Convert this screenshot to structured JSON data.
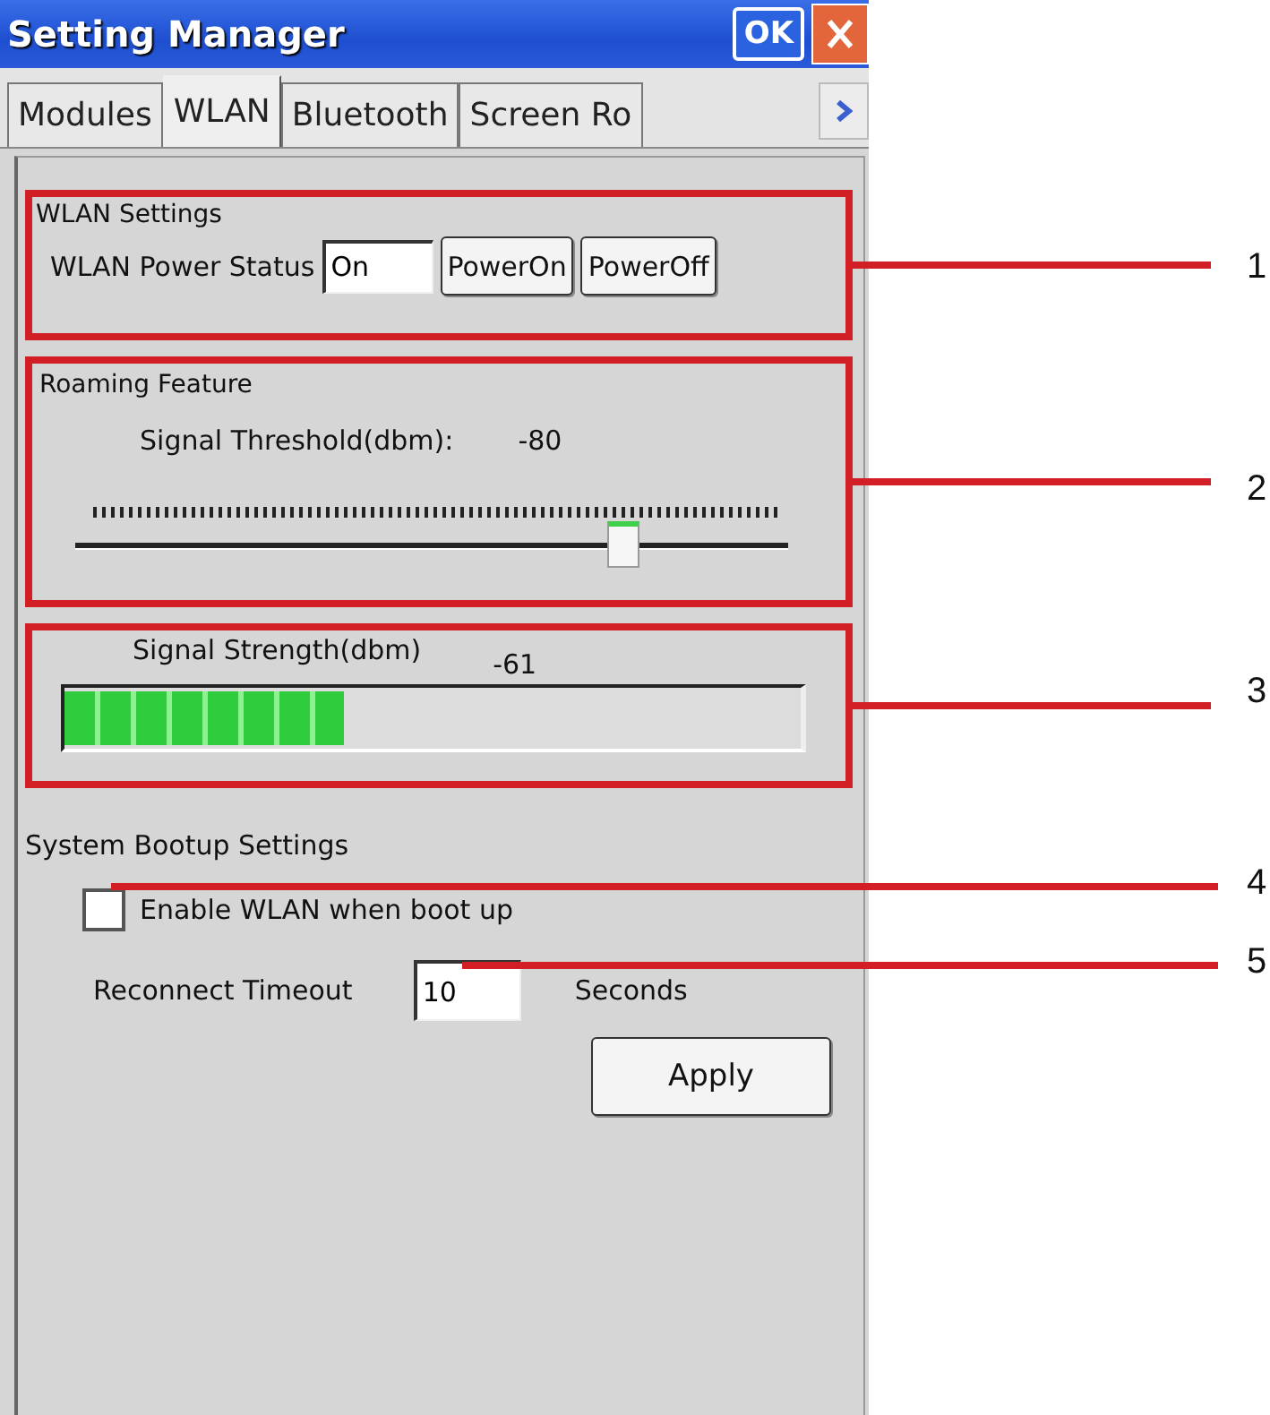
{
  "window": {
    "title": "Setting Manager",
    "ok_button": "OK"
  },
  "tabs": [
    {
      "label": "Modules",
      "selected": false
    },
    {
      "label": "WLAN",
      "selected": true
    },
    {
      "label": "Bluetooth",
      "selected": false
    },
    {
      "label": "Screen Ro",
      "selected": false
    }
  ],
  "wlan_settings": {
    "title": "WLAN Settings",
    "power_status_label": "WLAN Power Status",
    "power_status_value": "On",
    "buttons": [
      "PowerOn",
      "PowerOff"
    ]
  },
  "roaming_feature": {
    "title": "Roaming Feature",
    "threshold_label": "Signal Threshold(dbm):",
    "threshold_value": "-80",
    "slider": {
      "level": 0.77
    }
  },
  "signal": {
    "label": "Signal Strength(dbm)",
    "value": "-61",
    "level": 0.38
  },
  "bootup_settings": {
    "title": "System Bootup Settings",
    "enable_checkbox": {
      "label": "Enable WLAN when boot up",
      "checked": false
    },
    "timeout_label": "Reconnect Timeout",
    "timeout_value": "10",
    "timeout_unit": "Seconds",
    "apply_button": "Apply"
  },
  "callouts": [
    "1",
    "2",
    "3",
    "4",
    "5"
  ]
}
